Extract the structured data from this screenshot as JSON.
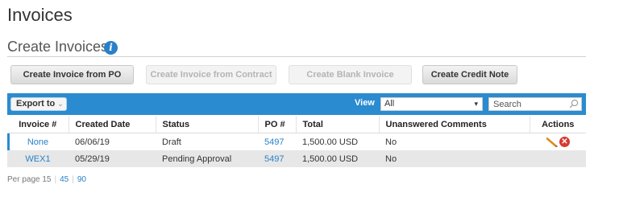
{
  "page": {
    "title": "Invoices"
  },
  "section": {
    "title": "Create Invoices"
  },
  "buttons": {
    "from_po": "Create Invoice from PO",
    "from_contract": "Create Invoice from Contract",
    "blank": "Create Blank Invoice",
    "credit_note": "Create Credit Note"
  },
  "toolbar": {
    "export_label": "Export to",
    "view_label": "View",
    "view_value": "All",
    "search_placeholder": "Search"
  },
  "table": {
    "headers": {
      "invoice_no": "Invoice #",
      "created_date": "Created Date",
      "status": "Status",
      "po_no": "PO #",
      "total": "Total",
      "comments": "Unanswered Comments",
      "actions": "Actions"
    },
    "rows": [
      {
        "invoice": "None",
        "date": "06/06/19",
        "status": "Draft",
        "po": "5497",
        "total": "1,500.00 USD",
        "comments": "No",
        "actions": [
          "edit-pencil",
          "delete"
        ]
      },
      {
        "invoice": "WEX1",
        "date": "05/29/19",
        "status": "Pending Approval",
        "po": "5497",
        "total": "1,500.00 USD",
        "comments": "No",
        "actions": []
      }
    ]
  },
  "pager": {
    "label": "Per page",
    "current": "15",
    "options": [
      "45",
      "90"
    ]
  },
  "colors": {
    "toolbar_blue": "#2a8bd0",
    "link_blue": "#2a82c8",
    "delete_red": "#d83a32",
    "pencil_orange": "#e08a1e"
  }
}
